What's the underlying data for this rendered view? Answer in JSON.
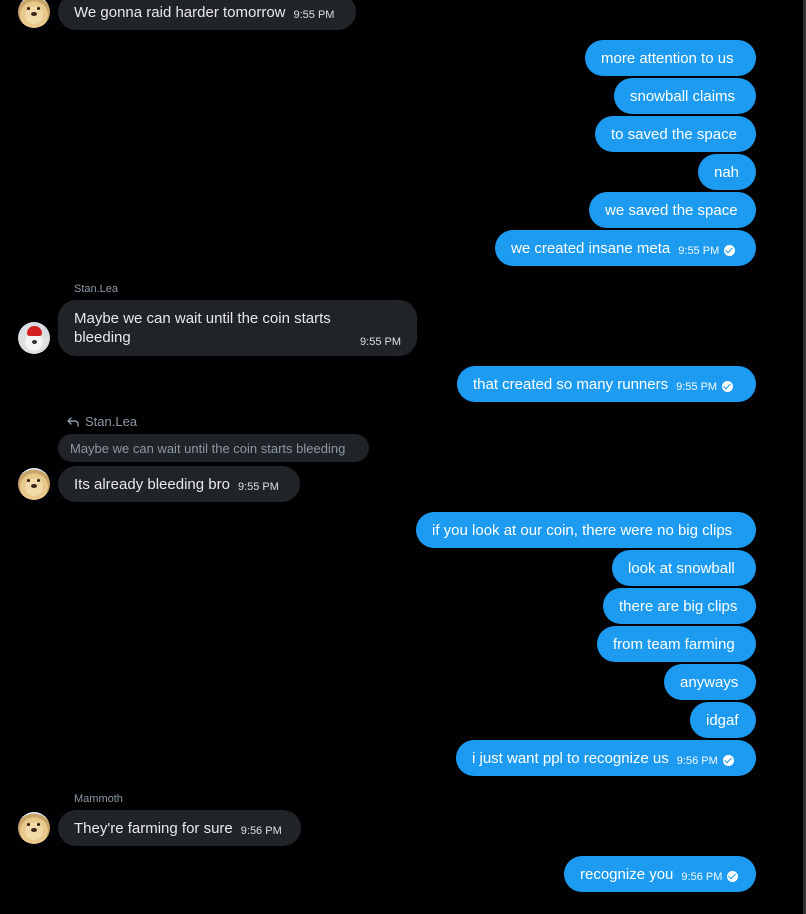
{
  "colors": {
    "background": "#000000",
    "incoming_bubble": "#202327",
    "outgoing_bubble": "#1d9bf0",
    "muted_text": "#8b98a5"
  },
  "icons": {
    "sent_check": "check-circle-icon",
    "reply": "reply-arrow-icon"
  },
  "messages": {
    "m1": {
      "text": "We gonna raid harder tomorrow",
      "time": "9:55 PM"
    },
    "m2": {
      "text": "more attention to us"
    },
    "m3": {
      "text": "snowball claims"
    },
    "m4": {
      "text": "to saved the space"
    },
    "m5": {
      "text": "nah"
    },
    "m6": {
      "text": "we saved the space"
    },
    "m7": {
      "text": "we created insane meta",
      "time": "9:55 PM"
    },
    "m8": {
      "sender": "Stan.Lea",
      "line1": "Maybe we can wait until the coin starts",
      "line2": "bleeding",
      "time": "9:55 PM"
    },
    "m9": {
      "text": "that created so many runners",
      "time": "9:55 PM"
    },
    "m10": {
      "reply_to": "Stan.Lea",
      "quoted": "Maybe we can wait until the coin starts bleeding",
      "text": "Its already bleeding bro",
      "time": "9:55 PM"
    },
    "m11": {
      "text": "if you look at our coin, there were no big clips"
    },
    "m12": {
      "text": "look at snowball"
    },
    "m13": {
      "text": "there are big clips"
    },
    "m14": {
      "text": "from team farming"
    },
    "m15": {
      "text": "anyways"
    },
    "m16": {
      "text": "idgaf"
    },
    "m17": {
      "text": "i just want ppl to recognize us",
      "time": "9:56 PM"
    },
    "m18": {
      "sender": "Mammoth",
      "text": "They're farming for sure",
      "time": "9:56 PM"
    },
    "m19": {
      "text": "recognize you",
      "time": "9:56 PM"
    }
  }
}
